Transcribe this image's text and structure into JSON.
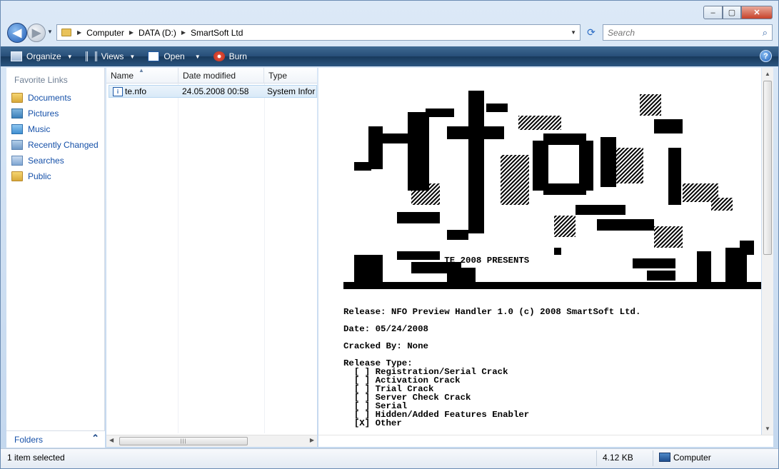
{
  "window": {
    "controls": {
      "minimize": "–",
      "maximize": "▢",
      "close": "✕"
    }
  },
  "nav": {
    "back_icon": "back-arrow-icon",
    "forward_icon": "forward-arrow-icon",
    "back_glyph": "◀",
    "forward_glyph": "▶",
    "history_glyph": "▼"
  },
  "address": {
    "breadcrumbs": [
      "Computer",
      "DATA (D:)",
      "SmartSoft Ltd"
    ],
    "separator": "▶",
    "dropdown_glyph": "▼",
    "refresh_glyph": "⟳"
  },
  "search": {
    "placeholder": "Search",
    "icon_glyph": "⌕"
  },
  "toolbar": {
    "organize": "Organize",
    "views": "Views",
    "open": "Open",
    "burn": "Burn",
    "dropdown_glyph": "▼",
    "help": "?"
  },
  "sidebar": {
    "heading": "Favorite Links",
    "items": [
      {
        "label": "Documents",
        "icon": "documents-folder-icon"
      },
      {
        "label": "Pictures",
        "icon": "pictures-icon"
      },
      {
        "label": "Music",
        "icon": "music-icon"
      },
      {
        "label": "Recently Changed",
        "icon": "recently-changed-icon"
      },
      {
        "label": "Searches",
        "icon": "searches-icon"
      },
      {
        "label": "Public",
        "icon": "public-folder-icon"
      }
    ],
    "folders_label": "Folders",
    "folders_chevron": "⌃"
  },
  "filelist": {
    "columns": [
      "Name",
      "Date modified",
      "Type"
    ],
    "sort_glyph": "▲",
    "rows": [
      {
        "name": "te.nfo",
        "date": "24.05.2008 00:58",
        "type": "System Information"
      }
    ],
    "scroll_left": "◀",
    "scroll_right": "▶",
    "scroll_grip": "|||"
  },
  "preview": {
    "nfo_text": "\n\n\n\n\n\n\n\n\n\n\n\n\n\n\n\n\n\n\n\n\n\n                   TE 2008 PRESENTS\n\n\n                 ANOTHER FINE RELEASE\n\n\nRelease: NFO Preview Handler 1.0 (c) 2008 SmartSoft Ltd.\n\nDate: 05/24/2008\n\nCracked By: None\n\nRelease Type:\n  [ ] Registration/Serial Crack\n  [ ] Activation Crack\n  [ ] Trial Crack\n  [ ] Server Check Crack\n  [ ] Serial\n  [ ] Hidden/Added Features Enabler\n  [X] Other",
    "scroll_up": "▲",
    "scroll_down": "▼"
  },
  "status": {
    "selection": "1 item selected",
    "size": "4.12 KB",
    "location": "Computer"
  }
}
